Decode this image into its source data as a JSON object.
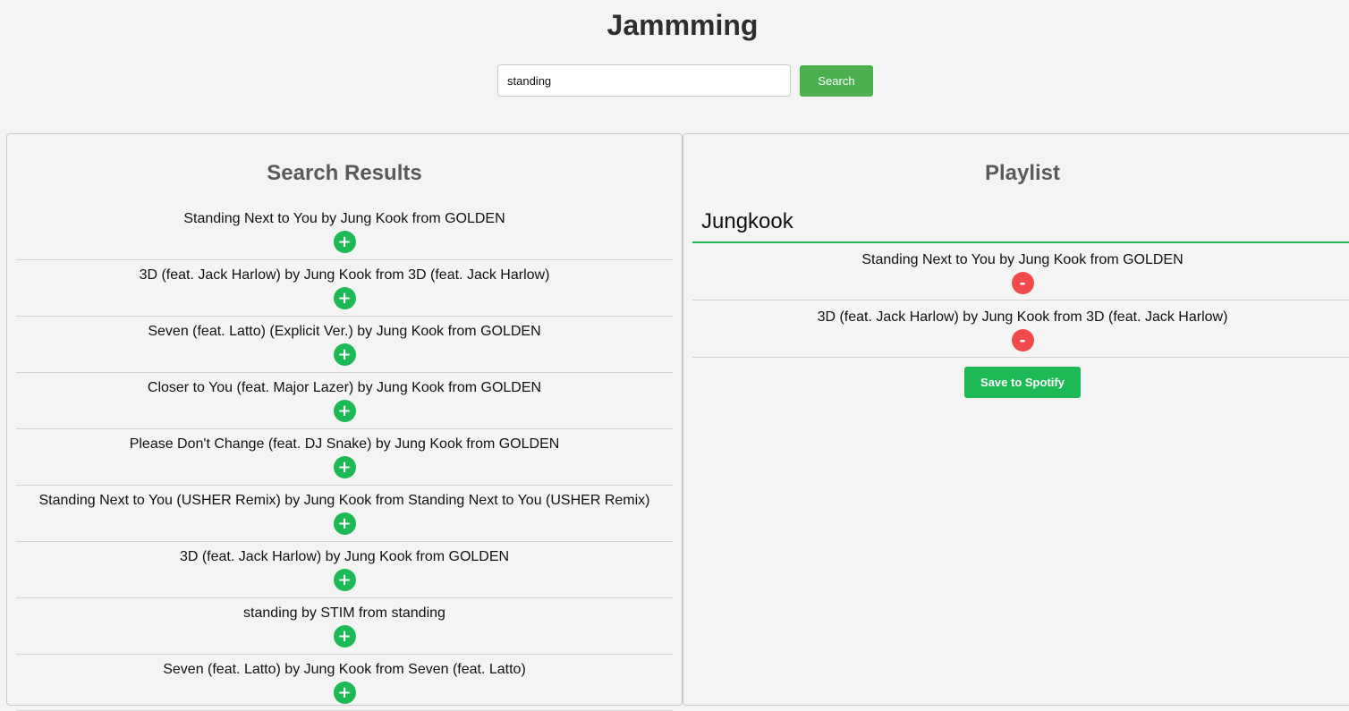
{
  "app": {
    "title": "Jammming"
  },
  "search": {
    "value": "standing",
    "button_label": "Search"
  },
  "results": {
    "title": "Search Results",
    "add_symbol": "+",
    "tracks": [
      "Standing Next to You by Jung Kook from GOLDEN",
      "3D (feat. Jack Harlow) by Jung Kook from 3D (feat. Jack Harlow)",
      "Seven (feat. Latto) (Explicit Ver.) by Jung Kook from GOLDEN",
      "Closer to You (feat. Major Lazer) by Jung Kook from GOLDEN",
      "Please Don't Change (feat. DJ Snake) by Jung Kook from GOLDEN",
      "Standing Next to You (USHER Remix) by Jung Kook from Standing Next to You (USHER Remix)",
      "3D (feat. Jack Harlow) by Jung Kook from GOLDEN",
      "standing by STIM from standing",
      "Seven (feat. Latto) by Jung Kook from Seven (feat. Latto)"
    ]
  },
  "playlist": {
    "title": "Playlist",
    "name": "Jungkook",
    "remove_symbol": "-",
    "tracks": [
      "Standing Next to You by Jung Kook from GOLDEN",
      "3D (feat. Jack Harlow) by Jung Kook from 3D (feat. Jack Harlow)"
    ],
    "save_label": "Save to Spotify"
  },
  "colors": {
    "accent_green": "#1db954",
    "search_green": "#4caf50",
    "remove_red": "#f04a4a",
    "background": "#f4f4f4"
  },
  "icons": {
    "add": "plus-icon",
    "remove": "minus-icon"
  }
}
